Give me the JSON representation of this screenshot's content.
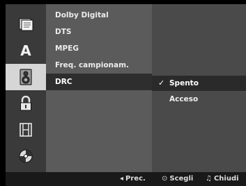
{
  "rail": {
    "icons": [
      {
        "name": "disc-settings-icon",
        "selected": false
      },
      {
        "name": "language-icon",
        "glyph": "A",
        "selected": false
      },
      {
        "name": "audio-speaker-icon",
        "selected": true
      },
      {
        "name": "lock-icon",
        "selected": false
      },
      {
        "name": "film-strip-icon",
        "selected": false
      },
      {
        "name": "disc-icon",
        "selected": false
      }
    ]
  },
  "menu": {
    "items": [
      {
        "label": "Dolby Digital"
      },
      {
        "label": "DTS"
      },
      {
        "label": "MPEG"
      },
      {
        "label": "Freq. campionam."
      },
      {
        "label": "DRC",
        "selected": true
      }
    ]
  },
  "options": {
    "items": [
      {
        "label": "Spento",
        "checked": true,
        "check_glyph": "✓"
      },
      {
        "label": "Acceso",
        "checked": false
      }
    ]
  },
  "helpbar": {
    "prev": {
      "glyph": "◂",
      "label": "Prec."
    },
    "select": {
      "glyph": "⊙",
      "label": "Scegli"
    },
    "close": {
      "glyph": "♫",
      "label": "Chiudi"
    }
  }
}
